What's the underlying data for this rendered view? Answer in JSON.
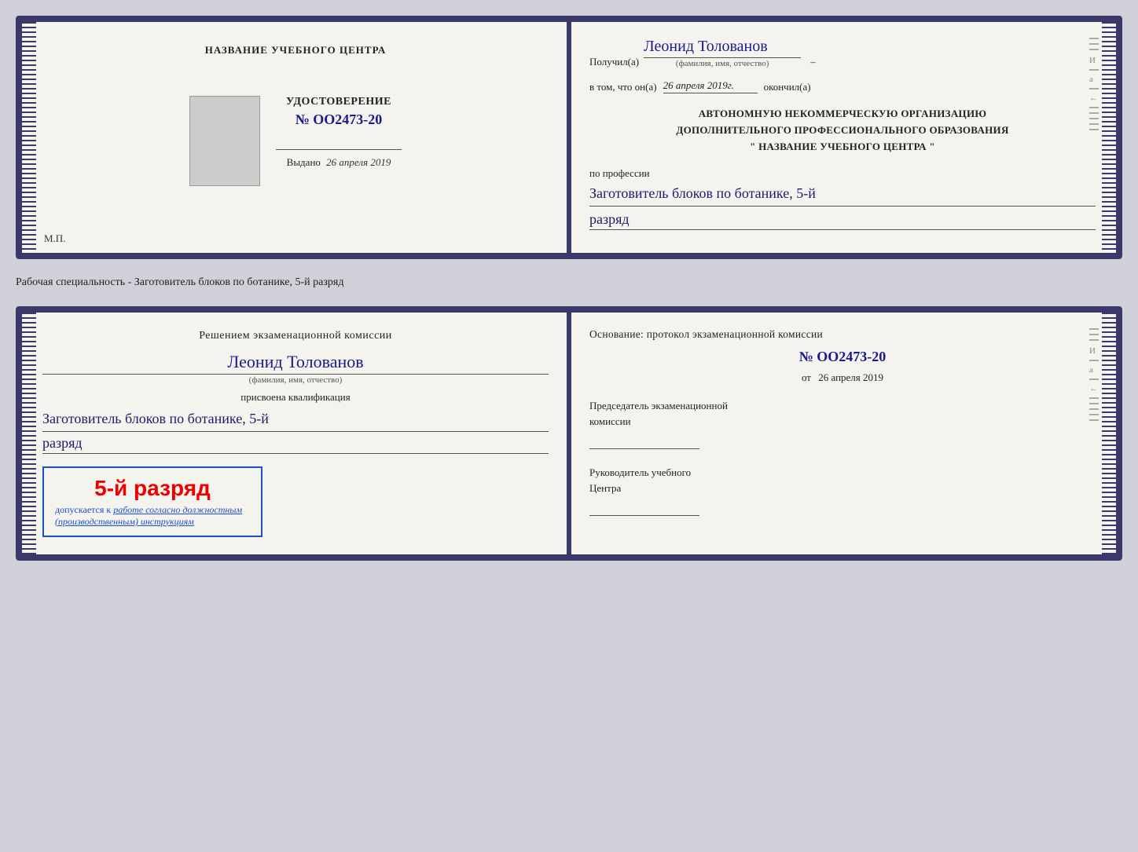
{
  "upper_doc": {
    "left": {
      "center_name": "НАЗВАНИЕ УЧЕБНОГО ЦЕНТРА",
      "udostoverenie_title": "УДОСТОВЕРЕНИЕ",
      "number": "№ OO2473-20",
      "vydano_label": "Выдано",
      "vydano_date": "26 апреля 2019",
      "mp_label": "М.П."
    },
    "right": {
      "poluchil_label": "Получил(а)",
      "recipient_name": "Леонид Толованов",
      "fio_sublabel": "(фамилия, имя, отчество)",
      "vtom_label": "в том, что он(а)",
      "date_value": "26 апреля 2019г.",
      "okonchil_label": "окончил(а)",
      "org_line1": "АВТОНОМНУЮ НЕКОММЕРЧЕСКУЮ ОРГАНИЗАЦИЮ",
      "org_line2": "ДОПОЛНИТЕЛЬНОГО ПРОФЕССИОНАЛЬНОГО ОБРАЗОВАНИЯ",
      "org_name": "\"  НАЗВАНИЕ УЧЕБНОГО ЦЕНТРА  \"",
      "po_professii_label": "по профессии",
      "profession": "Заготовитель блоков по ботанике, 5-й",
      "razryad": "разряд"
    }
  },
  "specialty_label": "Рабочая специальность - Заготовитель блоков по ботанике, 5-й разряд",
  "lower_doc": {
    "left": {
      "resheniem_line1": "Решением экзаменационной комиссии",
      "recipient_name": "Леонид Толованов",
      "fio_sublabel": "(фамилия, имя, отчество)",
      "prisvoena_label": "присвоена квалификация",
      "profession": "Заготовитель блоков по ботанике, 5-й",
      "razryad": "разряд",
      "stamp_grade": "5-й разряд",
      "dopusk_text": "допускается к ",
      "dopusk_italic": "работе согласно должностным (производственным) инструкциям"
    },
    "right": {
      "osnovanie_label": "Основание: протокол экзаменационной комиссии",
      "proto_number": "№  OO2473-20",
      "ot_label": "от",
      "ot_date": "26 апреля 2019",
      "predsedatel_line1": "Председатель экзаменационной",
      "predsedatel_line2": "комиссии",
      "rukovoditel_line1": "Руководитель учебного",
      "rukovoditel_line2": "Центра"
    }
  },
  "decorative": {
    "И": "И",
    "а": "а",
    "left_arrow": "←"
  }
}
